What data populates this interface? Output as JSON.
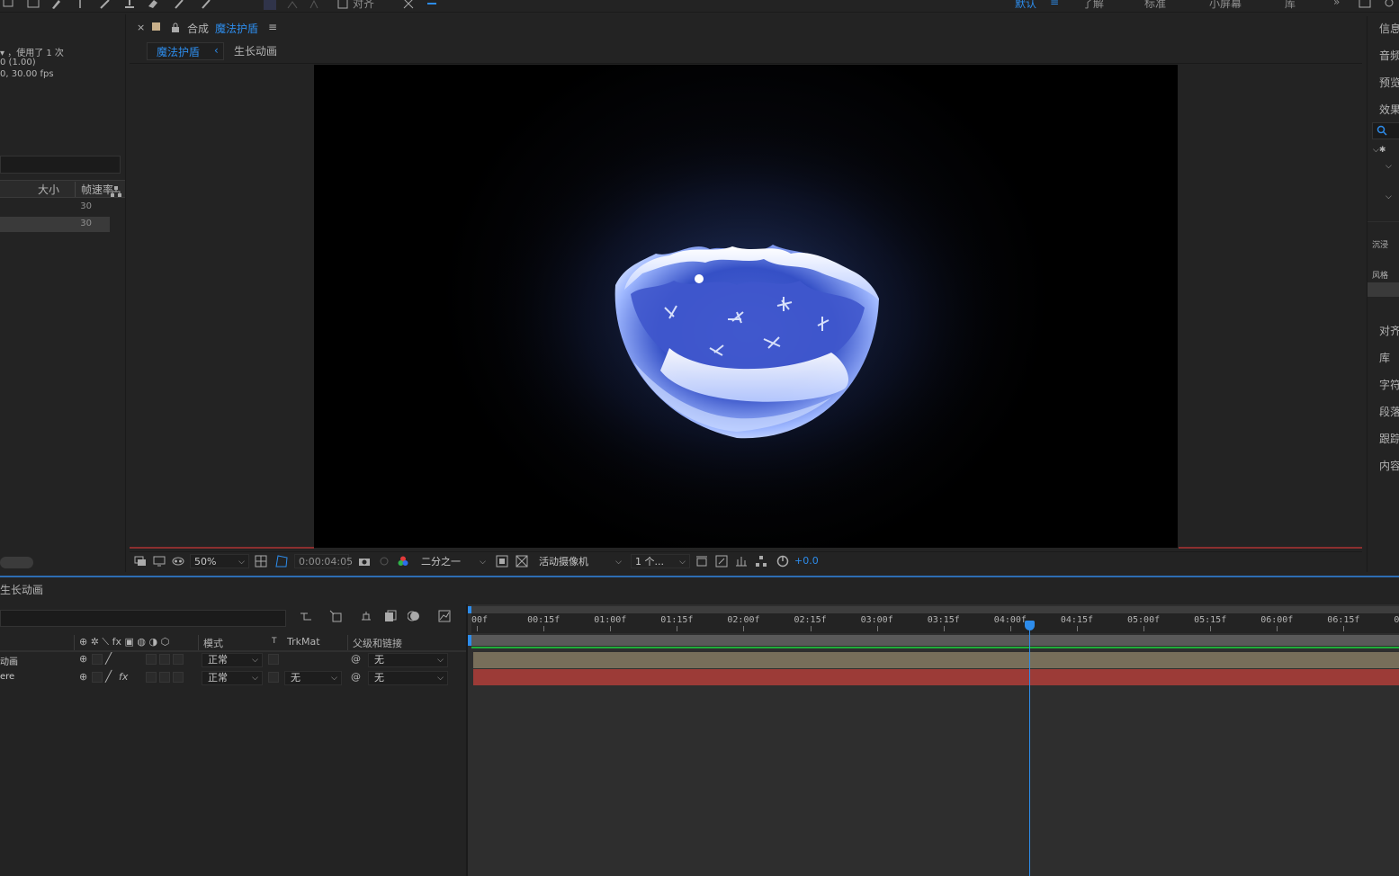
{
  "toolbar": {
    "align_label": "对齐",
    "workspaces": [
      "默认",
      "了解",
      "标准",
      "小屏幕",
      "库"
    ],
    "active_workspace": "默认",
    "menu_icon": "≡",
    "more": "»"
  },
  "project": {
    "info_line1": "▾ ，使用了 1 次",
    "info_line2": "0 (1.00)",
    "info_line3": "0, 30.00 fps",
    "col_size": "大小",
    "col_fps": "帧速率",
    "rows": [
      {
        "fps": "30"
      },
      {
        "fps": "30"
      }
    ]
  },
  "comp": {
    "close": "×",
    "prefix": "合成",
    "name": "魔法护盾",
    "menu": "≡",
    "subtabs": [
      "魔法护盾",
      "生长动画"
    ],
    "subtab_arrow": "‹",
    "zoom": "50%",
    "timecode": "0:00:04:05",
    "resolution": "二分之一",
    "camera": "活动摄像机",
    "views": "1 个...",
    "exposure": "+0.0"
  },
  "right_panels": [
    "信息",
    "音频",
    "预览",
    "效果",
    "对齐",
    "库",
    "字符",
    "段落",
    "跟踪",
    "内容"
  ],
  "right_tree": [
    "沉浸",
    "风格"
  ],
  "timeline": {
    "title": "生长动画",
    "columns": {
      "mode": "模式",
      "t": "T",
      "trkmat": "TrkMat",
      "parent": "父级和链接"
    },
    "layers": [
      {
        "name": "动画",
        "mode": "正常",
        "trkmat": "",
        "parent": "无"
      },
      {
        "name": "ere",
        "mode": "正常",
        "trkmat": "无",
        "parent": "无"
      }
    ],
    "ruler": [
      "00f",
      "00:15f",
      "01:00f",
      "01:15f",
      "02:00f",
      "02:15f",
      "03:00f",
      "03:15f",
      "04:00f",
      "04:15f",
      "05:00f",
      "05:15f",
      "06:00f",
      "06:15f",
      "07"
    ]
  }
}
